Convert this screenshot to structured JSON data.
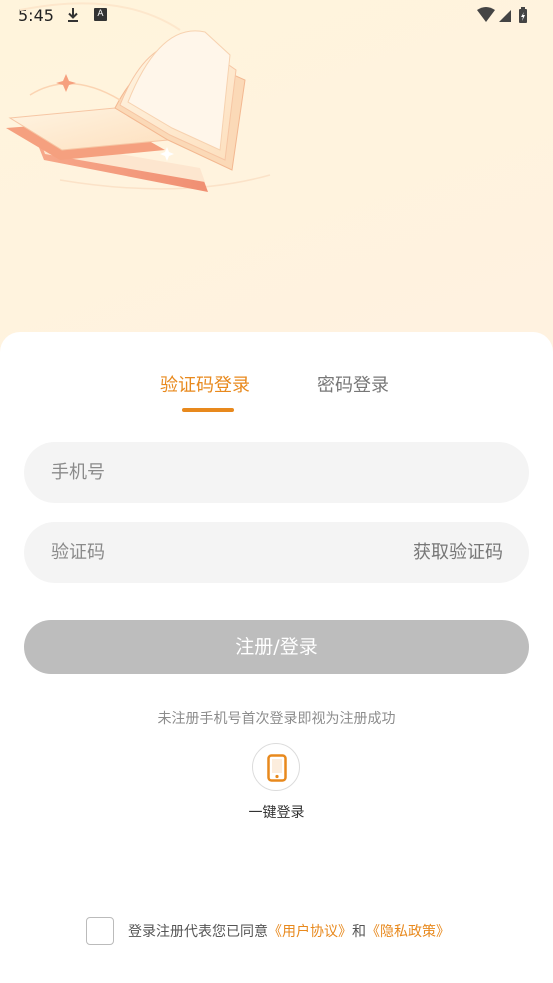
{
  "status_bar": {
    "time": "5:45",
    "download_icon": "download-icon",
    "a_badge": "A",
    "wifi_icon": "wifi-icon",
    "signal_icon": "signal-icon",
    "battery_icon": "battery-icon"
  },
  "hero": {
    "illustration": "open-book-illustration"
  },
  "tabs": {
    "sms_login": "验证码登录",
    "password_login": "密码登录",
    "active": "sms_login"
  },
  "form": {
    "phone_placeholder": "手机号",
    "phone_value": "",
    "code_placeholder": "验证码",
    "code_value": "",
    "get_code": "获取验证码",
    "submit": "注册/登录"
  },
  "hint": "未注册手机号首次登录即视为注册成功",
  "one_key": {
    "label": "一键登录",
    "icon": "phone-icon"
  },
  "agreement": {
    "checked": false,
    "prefix": "登录注册代表您已同意",
    "user_agreement": "《用户协议》",
    "and": "和",
    "privacy_policy": "《隐私政策》"
  },
  "colors": {
    "accent": "#e8891d",
    "button_disabled": "#bdbdbd",
    "field_bg": "#f4f4f4"
  }
}
